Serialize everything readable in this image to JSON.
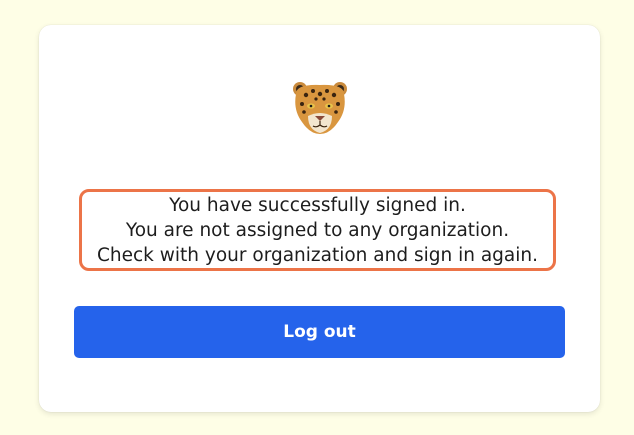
{
  "logo": {
    "icon": "jaguar-head-icon"
  },
  "message": {
    "lines": [
      "You have successfully signed in.",
      "You are not assigned to any organization.",
      "Check with your organization and sign in again."
    ]
  },
  "actions": {
    "logout_label": "Log out"
  },
  "colors": {
    "page_background": "#fefee6",
    "card_background": "#ffffff",
    "highlight_border": "#ec7448",
    "button_background": "#2563eb",
    "button_text": "#ffffff",
    "text": "#1d1d1d"
  }
}
